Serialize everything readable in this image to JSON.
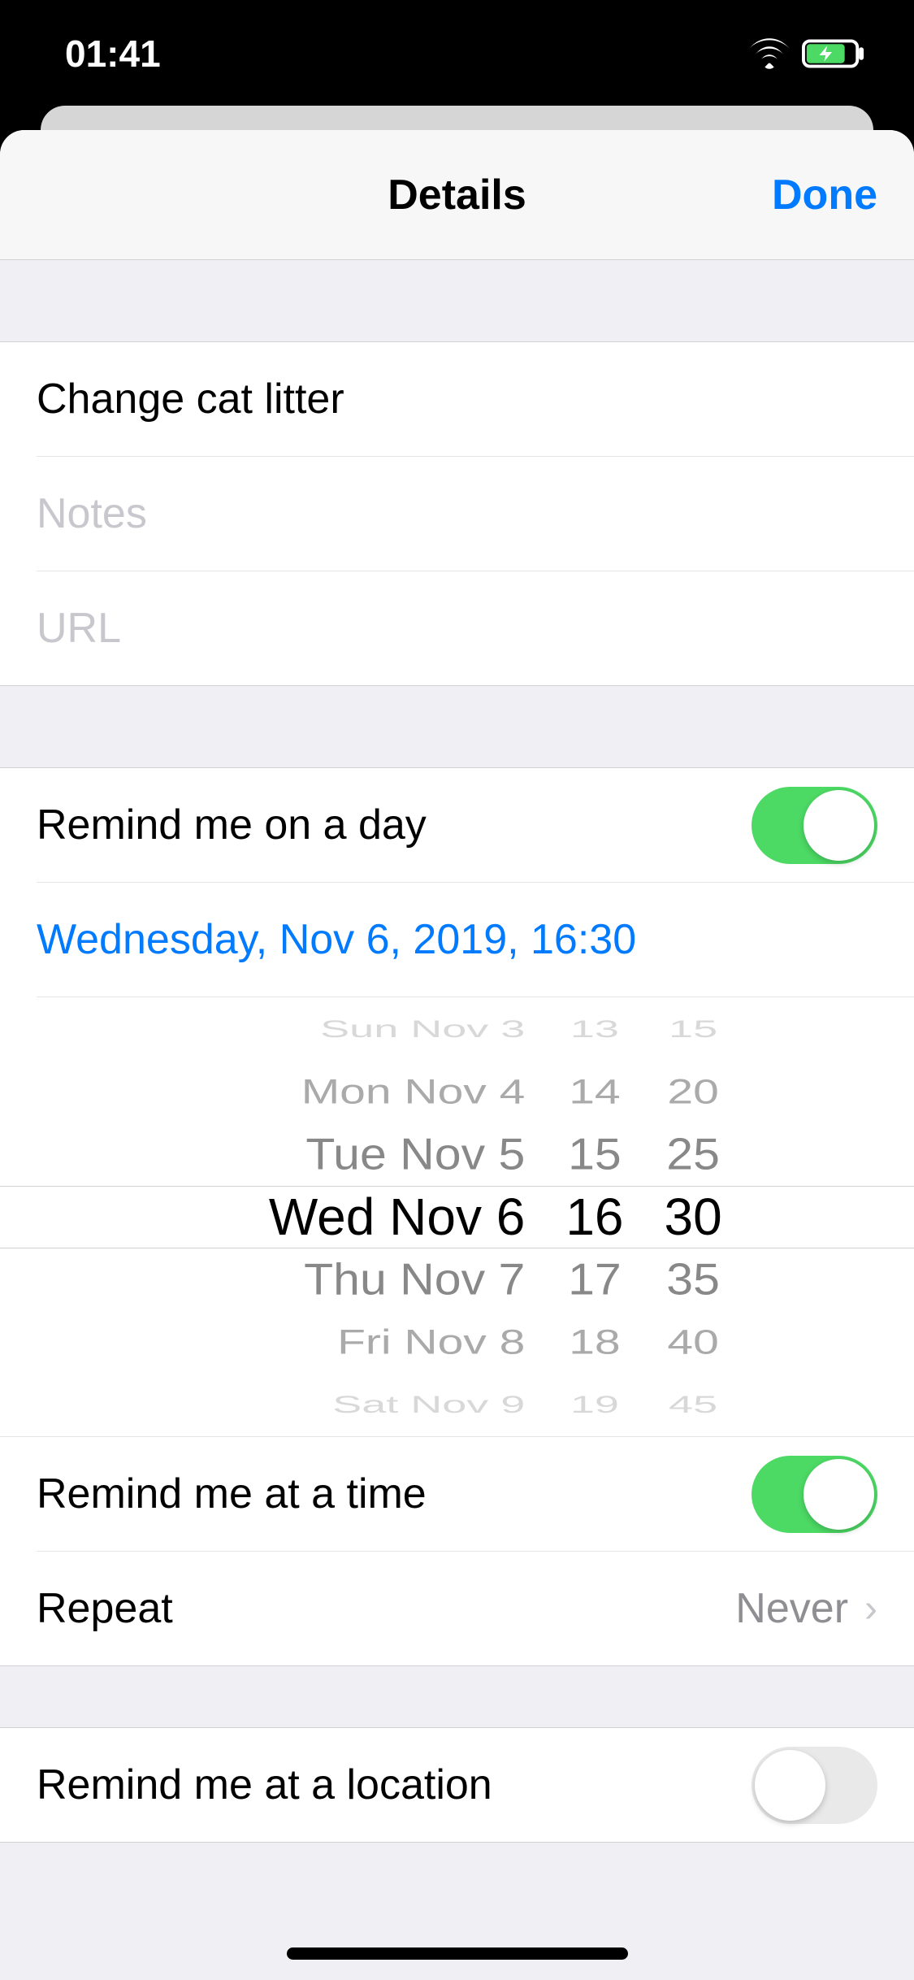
{
  "statusBar": {
    "time": "01:41"
  },
  "nav": {
    "title": "Details",
    "done": "Done"
  },
  "reminder": {
    "title": "Change cat litter",
    "notesPlaceholder": "Notes",
    "urlPlaceholder": "URL"
  },
  "dayRemind": {
    "label": "Remind me on a day",
    "enabled": true,
    "dateDisplay": "Wednesday, Nov 6, 2019, 16:30"
  },
  "picker": {
    "dates": [
      "Sun Nov 3",
      "Mon Nov 4",
      "Tue Nov 5",
      "Wed Nov 6",
      "Thu Nov 7",
      "Fri Nov 8",
      "Sat Nov 9"
    ],
    "hours": [
      "13",
      "14",
      "15",
      "16",
      "17",
      "18",
      "19"
    ],
    "minutes": [
      "15",
      "20",
      "25",
      "30",
      "35",
      "40",
      "45"
    ]
  },
  "timeRemind": {
    "label": "Remind me at a time",
    "enabled": true
  },
  "repeat": {
    "label": "Repeat",
    "value": "Never"
  },
  "locationRemind": {
    "label": "Remind me at a location",
    "enabled": false
  }
}
